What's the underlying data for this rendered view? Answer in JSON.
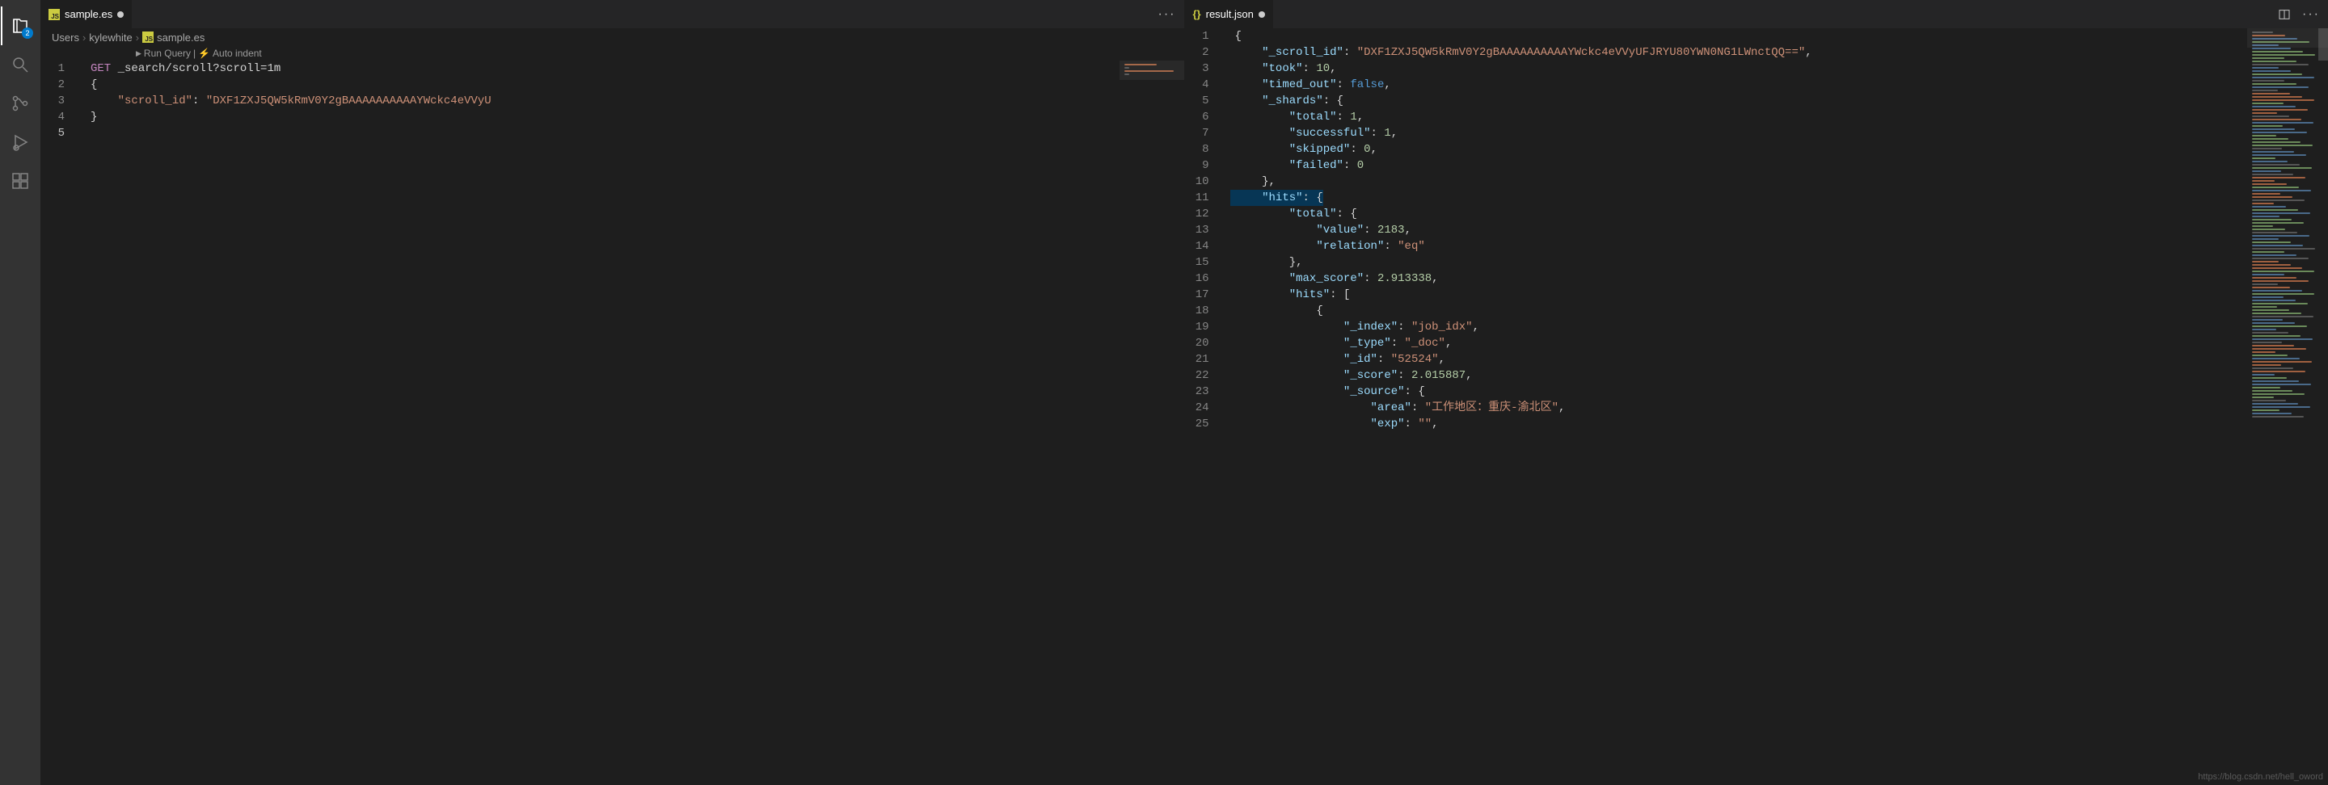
{
  "activity_bar": {
    "explorer_badge": "2"
  },
  "left_pane": {
    "tab": {
      "filename": "sample.es",
      "dirty": true
    },
    "breadcrumbs": [
      "Users",
      "kylewhite",
      "sample.es"
    ],
    "hints": {
      "run": "Run Query",
      "sep": "|",
      "auto": "Auto indent"
    },
    "code": {
      "lines": [
        [
          {
            "cls": "tok-method",
            "t": "GET"
          },
          {
            "cls": "tok-path",
            "t": " _search/scroll?scroll=1m"
          }
        ],
        [
          {
            "cls": "tok-punct",
            "t": "{"
          }
        ],
        [
          {
            "cls": "tok-punct",
            "t": "    "
          },
          {
            "cls": "tok-key",
            "t": "\"scroll_id\""
          },
          {
            "cls": "tok-punct",
            "t": ": "
          },
          {
            "cls": "tok-string",
            "t": "\"DXF1ZXJ5QW5kRmV0Y2gBAAAAAAAAAAYWckc4eVVyU"
          }
        ],
        [
          {
            "cls": "tok-punct",
            "t": "}"
          }
        ],
        [
          {
            "cls": "tok-punct",
            "t": ""
          }
        ]
      ],
      "active_line_index": 4
    }
  },
  "right_pane": {
    "tab": {
      "filename": "result.json",
      "dirty": true
    },
    "code": {
      "highlighted_line_index": 10,
      "lines": [
        [
          {
            "cls": "tok-punct",
            "t": "{"
          }
        ],
        [
          {
            "cls": "tok-punct",
            "t": "    "
          },
          {
            "cls": "tok-strblue",
            "t": "\"_scroll_id\""
          },
          {
            "cls": "tok-punct",
            "t": ": "
          },
          {
            "cls": "tok-string",
            "t": "\"DXF1ZXJ5QW5kRmV0Y2gBAAAAAAAAAAYWckc4eVVyUFJRYU80YWN0NG1LWnctQQ==\""
          },
          {
            "cls": "tok-punct",
            "t": ","
          }
        ],
        [
          {
            "cls": "tok-punct",
            "t": "    "
          },
          {
            "cls": "tok-strblue",
            "t": "\"took\""
          },
          {
            "cls": "tok-punct",
            "t": ": "
          },
          {
            "cls": "tok-num",
            "t": "10"
          },
          {
            "cls": "tok-punct",
            "t": ","
          }
        ],
        [
          {
            "cls": "tok-punct",
            "t": "    "
          },
          {
            "cls": "tok-strblue",
            "t": "\"timed_out\""
          },
          {
            "cls": "tok-punct",
            "t": ": "
          },
          {
            "cls": "tok-bool",
            "t": "false"
          },
          {
            "cls": "tok-punct",
            "t": ","
          }
        ],
        [
          {
            "cls": "tok-punct",
            "t": "    "
          },
          {
            "cls": "tok-strblue",
            "t": "\"_shards\""
          },
          {
            "cls": "tok-punct",
            "t": ": {"
          }
        ],
        [
          {
            "cls": "tok-punct",
            "t": "        "
          },
          {
            "cls": "tok-strblue",
            "t": "\"total\""
          },
          {
            "cls": "tok-punct",
            "t": ": "
          },
          {
            "cls": "tok-num",
            "t": "1"
          },
          {
            "cls": "tok-punct",
            "t": ","
          }
        ],
        [
          {
            "cls": "tok-punct",
            "t": "        "
          },
          {
            "cls": "tok-strblue",
            "t": "\"successful\""
          },
          {
            "cls": "tok-punct",
            "t": ": "
          },
          {
            "cls": "tok-num",
            "t": "1"
          },
          {
            "cls": "tok-punct",
            "t": ","
          }
        ],
        [
          {
            "cls": "tok-punct",
            "t": "        "
          },
          {
            "cls": "tok-strblue",
            "t": "\"skipped\""
          },
          {
            "cls": "tok-punct",
            "t": ": "
          },
          {
            "cls": "tok-num",
            "t": "0"
          },
          {
            "cls": "tok-punct",
            "t": ","
          }
        ],
        [
          {
            "cls": "tok-punct",
            "t": "        "
          },
          {
            "cls": "tok-strblue",
            "t": "\"failed\""
          },
          {
            "cls": "tok-punct",
            "t": ": "
          },
          {
            "cls": "tok-num",
            "t": "0"
          }
        ],
        [
          {
            "cls": "tok-punct",
            "t": "    },"
          }
        ],
        [
          {
            "cls": "tok-punct",
            "t": "    "
          },
          {
            "cls": "tok-strblue",
            "t": "\"hits\""
          },
          {
            "cls": "tok-punct",
            "t": ": {"
          }
        ],
        [
          {
            "cls": "tok-punct",
            "t": "        "
          },
          {
            "cls": "tok-strblue",
            "t": "\"total\""
          },
          {
            "cls": "tok-punct",
            "t": ": {"
          }
        ],
        [
          {
            "cls": "tok-punct",
            "t": "            "
          },
          {
            "cls": "tok-strblue",
            "t": "\"value\""
          },
          {
            "cls": "tok-punct",
            "t": ": "
          },
          {
            "cls": "tok-num",
            "t": "2183"
          },
          {
            "cls": "tok-punct",
            "t": ","
          }
        ],
        [
          {
            "cls": "tok-punct",
            "t": "            "
          },
          {
            "cls": "tok-strblue",
            "t": "\"relation\""
          },
          {
            "cls": "tok-punct",
            "t": ": "
          },
          {
            "cls": "tok-string",
            "t": "\"eq\""
          }
        ],
        [
          {
            "cls": "tok-punct",
            "t": "        },"
          }
        ],
        [
          {
            "cls": "tok-punct",
            "t": "        "
          },
          {
            "cls": "tok-strblue",
            "t": "\"max_score\""
          },
          {
            "cls": "tok-punct",
            "t": ": "
          },
          {
            "cls": "tok-num",
            "t": "2.913338"
          },
          {
            "cls": "tok-punct",
            "t": ","
          }
        ],
        [
          {
            "cls": "tok-punct",
            "t": "        "
          },
          {
            "cls": "tok-strblue",
            "t": "\"hits\""
          },
          {
            "cls": "tok-punct",
            "t": ": ["
          }
        ],
        [
          {
            "cls": "tok-punct",
            "t": "            {"
          }
        ],
        [
          {
            "cls": "tok-punct",
            "t": "                "
          },
          {
            "cls": "tok-strblue",
            "t": "\"_index\""
          },
          {
            "cls": "tok-punct",
            "t": ": "
          },
          {
            "cls": "tok-string",
            "t": "\"job_idx\""
          },
          {
            "cls": "tok-punct",
            "t": ","
          }
        ],
        [
          {
            "cls": "tok-punct",
            "t": "                "
          },
          {
            "cls": "tok-strblue",
            "t": "\"_type\""
          },
          {
            "cls": "tok-punct",
            "t": ": "
          },
          {
            "cls": "tok-string",
            "t": "\"_doc\""
          },
          {
            "cls": "tok-punct",
            "t": ","
          }
        ],
        [
          {
            "cls": "tok-punct",
            "t": "                "
          },
          {
            "cls": "tok-strblue",
            "t": "\"_id\""
          },
          {
            "cls": "tok-punct",
            "t": ": "
          },
          {
            "cls": "tok-string",
            "t": "\"52524\""
          },
          {
            "cls": "tok-punct",
            "t": ","
          }
        ],
        [
          {
            "cls": "tok-punct",
            "t": "                "
          },
          {
            "cls": "tok-strblue",
            "t": "\"_score\""
          },
          {
            "cls": "tok-punct",
            "t": ": "
          },
          {
            "cls": "tok-num",
            "t": "2.015887"
          },
          {
            "cls": "tok-punct",
            "t": ","
          }
        ],
        [
          {
            "cls": "tok-punct",
            "t": "                "
          },
          {
            "cls": "tok-strblue",
            "t": "\"_source\""
          },
          {
            "cls": "tok-punct",
            "t": ": {"
          }
        ],
        [
          {
            "cls": "tok-punct",
            "t": "                    "
          },
          {
            "cls": "tok-strblue",
            "t": "\"area\""
          },
          {
            "cls": "tok-punct",
            "t": ": "
          },
          {
            "cls": "tok-string",
            "t": "\"工作地区：重庆-渝北区\""
          },
          {
            "cls": "tok-punct",
            "t": ","
          }
        ],
        [
          {
            "cls": "tok-punct",
            "t": "                    "
          },
          {
            "cls": "tok-strblue",
            "t": "\"exp\""
          },
          {
            "cls": "tok-punct",
            "t": ": "
          },
          {
            "cls": "tok-string",
            "t": "\"\""
          },
          {
            "cls": "tok-punct",
            "t": ","
          }
        ]
      ]
    }
  },
  "watermark": "https://blog.csdn.net/hell_oword"
}
